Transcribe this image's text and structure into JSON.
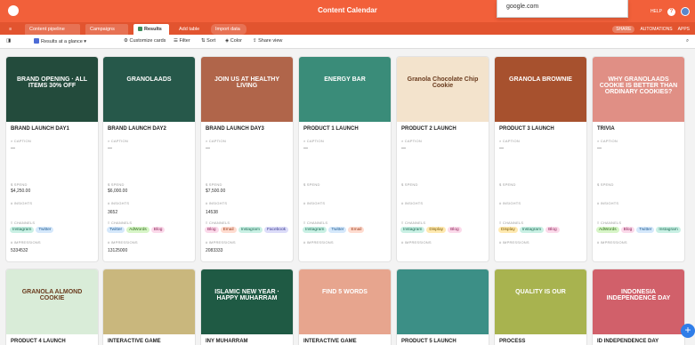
{
  "app": {
    "base_title": "Content Calendar",
    "url_popup": "google.com",
    "help_label": "HELP",
    "share_label": "SHARE",
    "automations_label": "AUTOMATIONS",
    "apps_label": "APPS"
  },
  "tabs": [
    {
      "label": "Content pipeline"
    },
    {
      "label": "Campaigns"
    },
    {
      "label": "Results"
    },
    {
      "label": "Add table"
    },
    {
      "label": "Import data"
    }
  ],
  "toolbar": {
    "view_name": "Results at a glance",
    "customize": "Customize cards",
    "filter": "Filter",
    "sort": "Sort",
    "color": "Color",
    "share_view": "Share view"
  },
  "field_labels": {
    "caption": "CAPTION",
    "spend": "SPEND",
    "insights": "INSIGHTS",
    "channels": "CHANNELS",
    "impressions": "IMPRESSIONS"
  },
  "tag_colors": {
    "Instagram": {
      "bg": "#c9f0e4",
      "fg": "#1b6b53"
    },
    "Twitter": {
      "bg": "#d5e8fb",
      "fg": "#1d5a91"
    },
    "AdWords": {
      "bg": "#d7f5c7",
      "fg": "#2c6b16"
    },
    "Blog": {
      "bg": "#fbd9ea",
      "fg": "#8d2559"
    },
    "Email": {
      "bg": "#ffdcd0",
      "fg": "#9a3a17"
    },
    "Display": {
      "bg": "#ffe9b0",
      "fg": "#7b5a00"
    },
    "Facebook": {
      "bg": "#dcdcf9",
      "fg": "#3b3b91"
    }
  },
  "cards": [
    {
      "title": "BRAND LAUNCH DAY1",
      "cover_bg": "#234b3c",
      "cover_text": "BRAND OPENING · ALL ITEMS 30% OFF",
      "spend": "$4,250.00",
      "insights": "",
      "channels": [
        "Instagram",
        "Twitter"
      ],
      "impressions": "5334532"
    },
    {
      "title": "BRAND LAUNCH DAY2",
      "cover_bg": "#26584a",
      "cover_text": "GRANOLAADS",
      "spend": "$6,000.00",
      "insights": "3652",
      "channels": [
        "Twitter",
        "AdWords",
        "Blog"
      ],
      "impressions": "13125000"
    },
    {
      "title": "BRAND LAUNCH DAY3",
      "cover_bg": "#b0654a",
      "cover_text": "JOIN US AT HEALTHY LIVING",
      "spend": "$7,500.00",
      "insights": "14538",
      "channels": [
        "Blog",
        "Email",
        "Instagram",
        "Facebook"
      ],
      "impressions": "2083333"
    },
    {
      "title": "PRODUCT 1 LAUNCH",
      "cover_bg": "#3a8c79",
      "cover_text": "ENERGY BAR",
      "spend": "",
      "insights": "",
      "channels": [
        "Instagram",
        "Twitter",
        "Email"
      ],
      "impressions": ""
    },
    {
      "title": "PRODUCT 2 LAUNCH",
      "cover_bg": "#f3e3cc",
      "cover_text": "Granola Chocolate Chip Cookie",
      "spend": "",
      "insights": "",
      "channels": [
        "Instagram",
        "Display",
        "Blog"
      ],
      "impressions": ""
    },
    {
      "title": "PRODUCT 3 LAUNCH",
      "cover_bg": "#a7512e",
      "cover_text": "GRANOLA BROWNIE",
      "spend": "",
      "insights": "",
      "channels": [
        "Display",
        "Instagram",
        "Blog"
      ],
      "impressions": ""
    },
    {
      "title": "TRIVIA",
      "cover_bg": "#e08f85",
      "cover_text": "WHY GRANOLAADS COOKIE IS BETTER THAN ORDINARY COOKIES?",
      "spend": "",
      "insights": "",
      "channels": [
        "AdWords",
        "Blog",
        "Twitter",
        "Instagram"
      ],
      "impressions": ""
    },
    {
      "title": "PRODUCT 4 LAUNCH",
      "cover_bg": "#d9ecd8",
      "cover_text": "GRANOLA ALMOND COOKIE",
      "spend": "",
      "insights": "",
      "channels": [],
      "impressions": ""
    },
    {
      "title": "INTERACTIVE GAME",
      "cover_bg": "#c9b77d",
      "cover_text": "",
      "spend": "",
      "insights": "",
      "channels": [],
      "impressions": ""
    },
    {
      "title": "INY MUHARRAM",
      "cover_bg": "#1f5a44",
      "cover_text": "ISLAMIC NEW YEAR · HAPPY MUHARRAM",
      "spend": "",
      "insights": "",
      "channels": [],
      "impressions": ""
    },
    {
      "title": "INTERACTIVE GAME",
      "cover_bg": "#e7a58e",
      "cover_text": "FIND 5 WORDS",
      "spend": "",
      "insights": "",
      "channels": [],
      "impressions": ""
    },
    {
      "title": "PRODUCT 5 LAUNCH",
      "cover_bg": "#3c8f86",
      "cover_text": "",
      "spend": "",
      "insights": "",
      "channels": [],
      "impressions": ""
    },
    {
      "title": "PROCESS",
      "cover_bg": "#a8b34f",
      "cover_text": "QUALITY IS OUR",
      "spend": "",
      "insights": "",
      "channels": [],
      "impressions": ""
    },
    {
      "title": "ID INDEPENDENCE DAY",
      "cover_bg": "#d1606a",
      "cover_text": "INDONESIA INDEPENDENCE DAY",
      "spend": "",
      "insights": "",
      "channels": [],
      "impressions": ""
    }
  ],
  "fab_label": "+"
}
